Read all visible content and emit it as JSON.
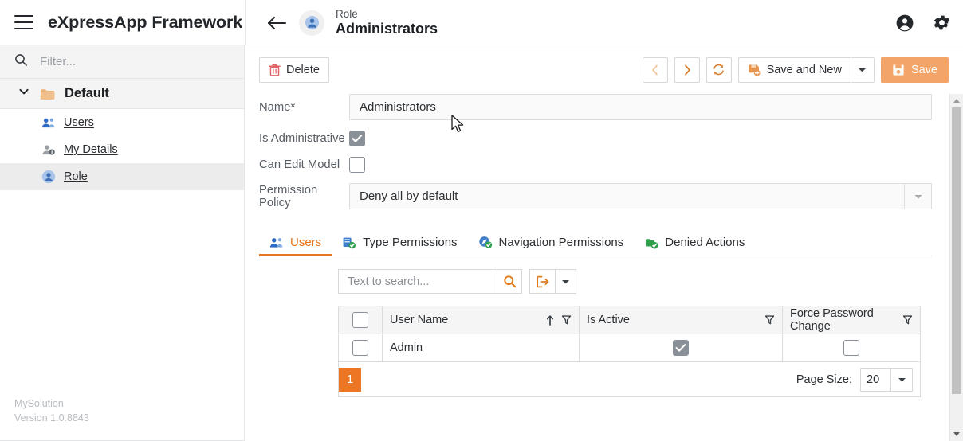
{
  "topbar": {
    "menu_icon": "hamburger-icon",
    "brand": "eXpressApp Framework",
    "account_icon": "account-circle-icon",
    "settings_icon": "gear-icon",
    "back_icon": "arrow-left-icon"
  },
  "detail_header": {
    "object_icon": "role-avatar-icon",
    "type": "Role",
    "title": "Administrators"
  },
  "sidebar": {
    "filter_placeholder": "Filter...",
    "filter_value": "",
    "search_icon": "search-icon",
    "group": {
      "chevron_icon": "chevron-down-icon",
      "folder_icon": "folder-icon",
      "label": "Default"
    },
    "items": [
      {
        "label": "Users",
        "icon": "users-group-icon",
        "selected": false
      },
      {
        "label": "My Details",
        "icon": "user-info-icon",
        "selected": false
      },
      {
        "label": "Role",
        "icon": "role-avatar-icon",
        "selected": true
      }
    ],
    "footer": {
      "solution": "MySolution",
      "version": "Version 1.0.8843"
    }
  },
  "toolbar": {
    "delete_label": "Delete",
    "delete_icon": "trash-icon",
    "prev_icon": "chevron-left-icon",
    "next_icon": "chevron-right-icon",
    "refresh_icon": "refresh-icon",
    "save_new_label": "Save and New",
    "save_new_icon": "save-new-icon",
    "dropdown_icon": "caret-down-icon",
    "save_label": "Save",
    "save_icon": "save-icon"
  },
  "form": {
    "name_label": "Name*",
    "name_value": "Administrators",
    "is_administrative_label": "Is Administrative",
    "is_administrative_checked": true,
    "can_edit_model_label": "Can Edit Model",
    "can_edit_model_checked": false,
    "permission_policy_label": "Permission Policy",
    "permission_policy_value": "Deny all by default",
    "permission_policy_dropdown_icon": "caret-down-icon"
  },
  "tabs": [
    {
      "label": "Users",
      "icon": "users-group-icon",
      "active": true
    },
    {
      "label": "Type Permissions",
      "icon": "type-permissions-icon",
      "active": false
    },
    {
      "label": "Navigation Permissions",
      "icon": "navigation-permissions-icon",
      "active": false
    },
    {
      "label": "Denied Actions",
      "icon": "denied-actions-icon",
      "active": false
    }
  ],
  "search": {
    "placeholder": "Text to search...",
    "value": "",
    "search_icon": "search-icon",
    "export_icon": "export-icon",
    "export_dropdown_icon": "caret-down-icon"
  },
  "grid": {
    "select_all_checked": false,
    "columns": [
      {
        "label": "User Name",
        "sort_icon": "sort-asc-icon",
        "filter_icon": "filter-icon"
      },
      {
        "label": "Is Active",
        "filter_icon": "filter-icon"
      },
      {
        "label": "Force Password Change",
        "filter_icon": "filter-icon"
      }
    ],
    "rows": [
      {
        "selected": false,
        "user_name": "Admin",
        "is_active": true,
        "force_password_change": false
      }
    ]
  },
  "pager": {
    "current_page": "1",
    "page_size_label": "Page Size:",
    "page_size_value": "20",
    "page_size_dropdown_icon": "caret-down-icon"
  },
  "scrollbar": {
    "up_icon": "scroll-up-icon",
    "down_icon": "scroll-down-icon"
  },
  "colors": {
    "accent_orange": "#ec7623",
    "accent_orange_light": "#f2a469",
    "tab_active": "#e8741c",
    "delete_red": "#e06464",
    "checkbox_gray": "#8a9097",
    "panel_gray": "#f4f4f4",
    "border": "#e4e6e8"
  }
}
